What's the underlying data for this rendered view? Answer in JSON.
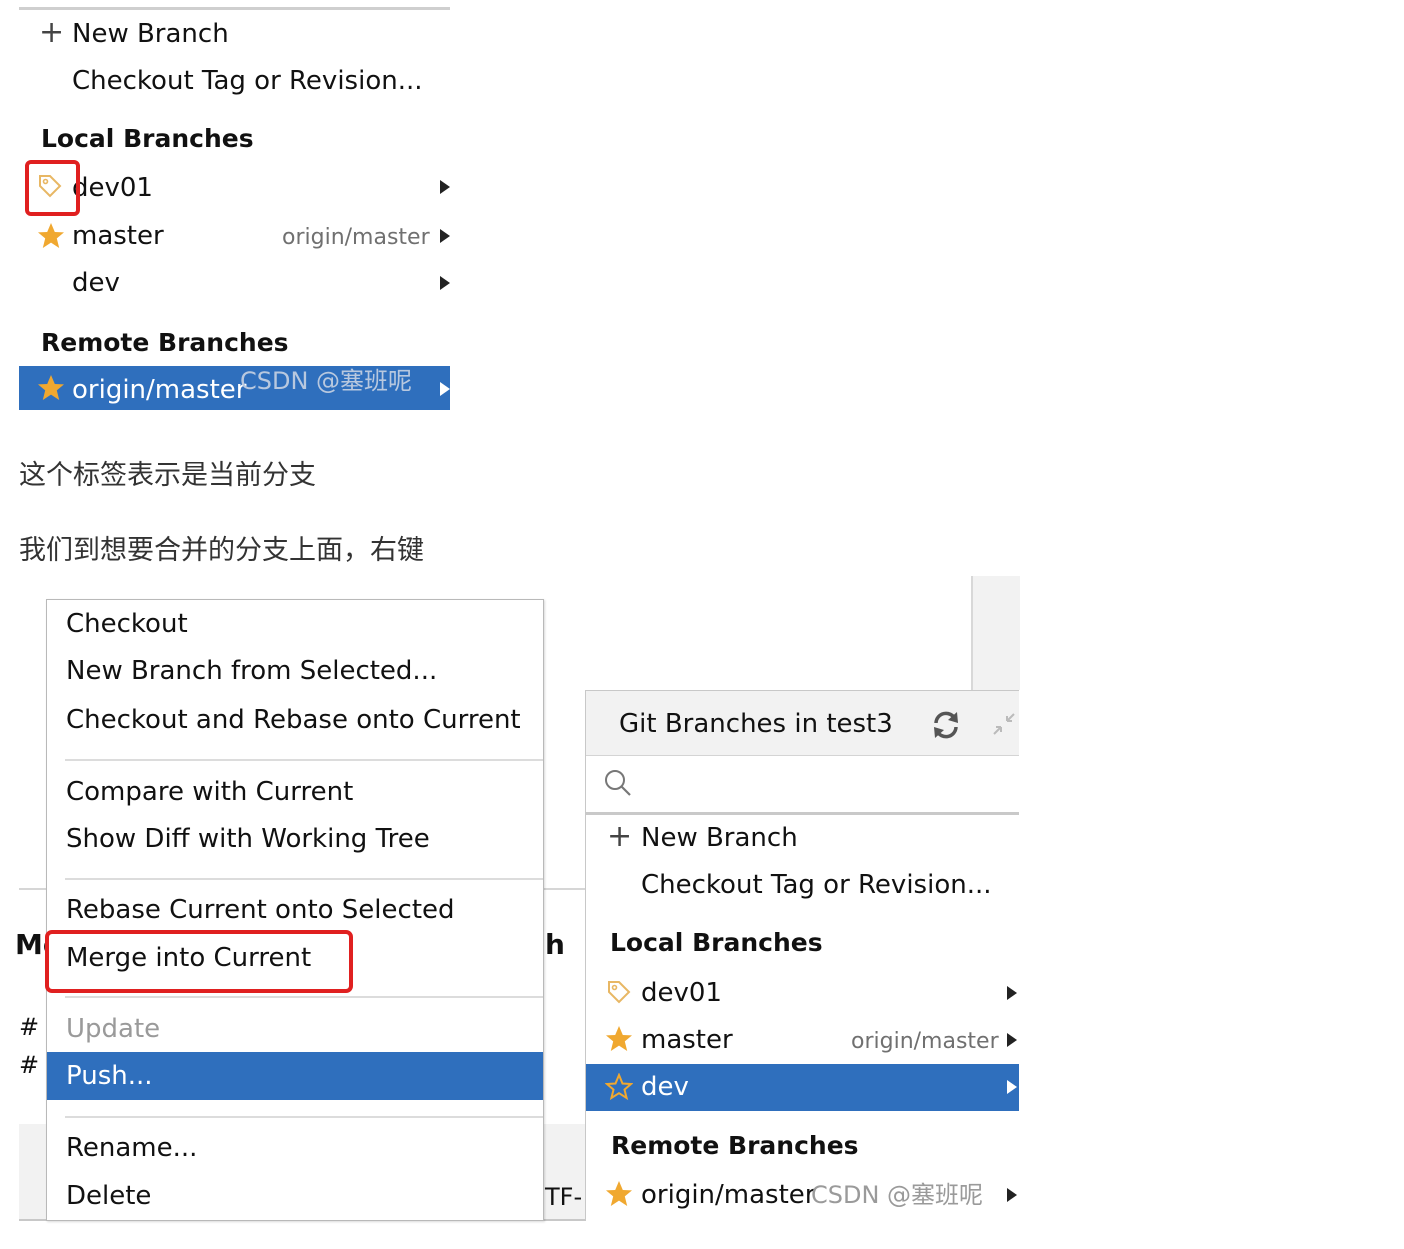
{
  "top_popup": {
    "new_branch": "New Branch",
    "checkout_tag": "Checkout Tag or Revision...",
    "local_header": "Local Branches",
    "local_branches": [
      {
        "name": "dev01",
        "tracking": "",
        "icon": "tag-icon"
      },
      {
        "name": "master",
        "tracking": "origin/master",
        "icon": "star-icon"
      },
      {
        "name": "dev",
        "tracking": "",
        "icon": ""
      }
    ],
    "remote_header": "Remote Branches",
    "remote_branches": [
      {
        "name": "origin/master",
        "icon": "star-icon",
        "selected": true
      }
    ],
    "watermark": "CSDN @塞班呢"
  },
  "paragraphs": {
    "p1": "这个标签表示是当前分支",
    "p2": "我们到想要合并的分支上面，右键"
  },
  "context_menu": {
    "items": [
      {
        "label": "Checkout"
      },
      {
        "label": "New Branch from Selected..."
      },
      {
        "label": "Checkout and Rebase onto Current"
      },
      {
        "label": "Compare with Current"
      },
      {
        "label": "Show Diff with Working Tree"
      },
      {
        "label": "Rebase Current onto Selected"
      },
      {
        "label": "Merge into Current"
      },
      {
        "label": "Update",
        "disabled": true
      },
      {
        "label": "Push...",
        "selected": true
      },
      {
        "label": "Rename..."
      },
      {
        "label": "Delete"
      }
    ]
  },
  "background_fragments": {
    "left_text": "Me",
    "hash1": "#",
    "hash2": "#",
    "right_text": "h",
    "bottom_text": "TF-"
  },
  "git_panel": {
    "title": "Git Branches in test3",
    "search_placeholder": "",
    "new_branch": "New Branch",
    "checkout_tag": "Checkout Tag or Revision...",
    "local_header": "Local Branches",
    "local_branches": [
      {
        "name": "dev01",
        "tracking": "",
        "icon": "tag-icon"
      },
      {
        "name": "master",
        "tracking": "origin/master",
        "icon": "star-icon"
      },
      {
        "name": "dev",
        "tracking": "",
        "icon": "star-outline-icon",
        "selected": true
      }
    ],
    "remote_header": "Remote Branches",
    "remote_branches": [
      {
        "name": "origin/master",
        "icon": "star-icon"
      }
    ],
    "watermark": "CSDN @塞班呢"
  },
  "colors": {
    "selection": "#2f6fbd",
    "highlight_box": "#e02020",
    "star": "#f0a830"
  }
}
